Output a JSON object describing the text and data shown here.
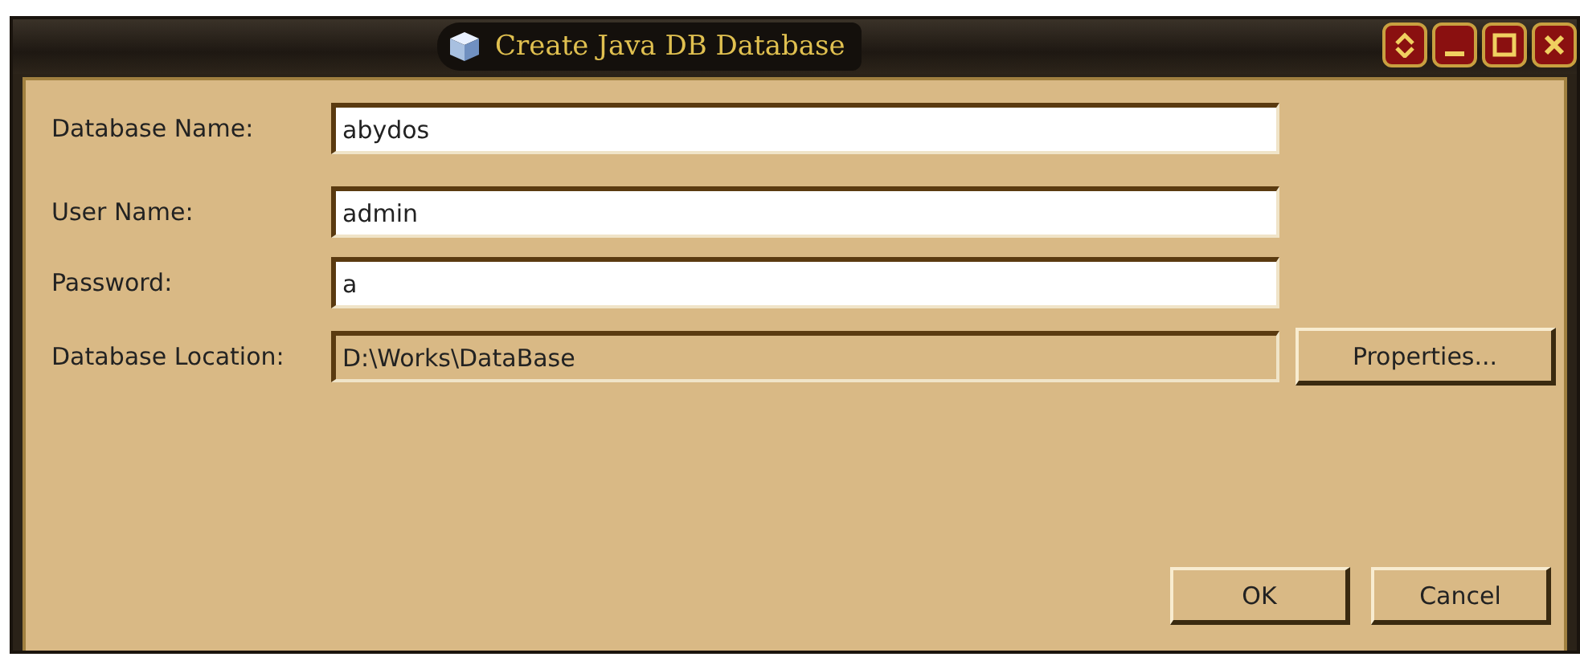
{
  "window": {
    "title": "Create Java DB Database"
  },
  "fields": [
    {
      "label": "Database Name:",
      "value": "abydos",
      "disabled": false
    },
    {
      "label": "User Name:",
      "value": "admin",
      "disabled": false
    },
    {
      "label": "Password:",
      "value": "a",
      "disabled": false
    },
    {
      "label": "Database Location:",
      "value": "D:\\Works\\DataBase",
      "disabled": true
    }
  ],
  "properties_button": "Properties...",
  "buttons": [
    "OK",
    "Cancel"
  ]
}
